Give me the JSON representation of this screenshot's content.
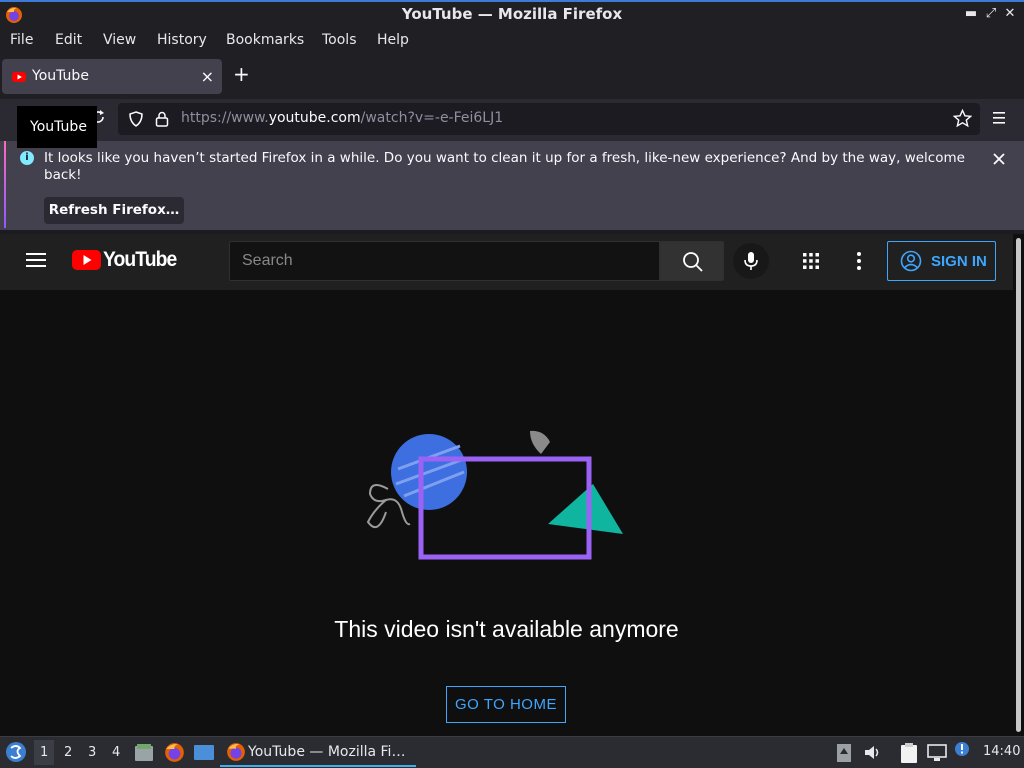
{
  "window": {
    "title": "YouTube — Mozilla Firefox"
  },
  "menu": {
    "items": [
      "File",
      "Edit",
      "View",
      "History",
      "Bookmarks",
      "Tools",
      "Help"
    ]
  },
  "tab": {
    "label": "YouTube",
    "close_glyph": "×",
    "new_tab_glyph": "+"
  },
  "tooltip": {
    "text": "YouTube"
  },
  "urlbar": {
    "prefix": "https://www.",
    "domain": "youtube.com",
    "path": "/watch?v=-e-Fei6LJ1"
  },
  "notification": {
    "message": "It looks like you haven’t started Firefox in a while. Do you want to clean it up for a fresh, like-new experience? And by the way, welcome back!",
    "button": "Refresh Firefox…"
  },
  "youtube": {
    "logo_text": "YouTube",
    "search_placeholder": "Search",
    "sign_in": "SIGN IN",
    "unavailable_message": "This video isn't available anymore",
    "go_home": "GO TO HOME"
  },
  "taskbar": {
    "workspaces": [
      "1",
      "2",
      "3",
      "4"
    ],
    "active_workspace": "1",
    "task_label": "YouTube — Mozilla Fi…",
    "clock": "14:40"
  },
  "colors": {
    "accent_blue": "#3ea6ff",
    "youtube_red": "#ff0000",
    "titlebar_bg": "#1f1f24",
    "page_bg": "#0f0f0f"
  },
  "icons": [
    "firefox-icon",
    "minimize-icon",
    "maximize-icon",
    "close-icon",
    "reload-icon",
    "shield-icon",
    "lock-icon",
    "star-icon",
    "menu-icon",
    "info-icon",
    "hamburger-icon",
    "youtube-logo-icon",
    "search-icon",
    "mic-icon",
    "apps-grid-icon",
    "more-vert-icon",
    "account-icon"
  ]
}
